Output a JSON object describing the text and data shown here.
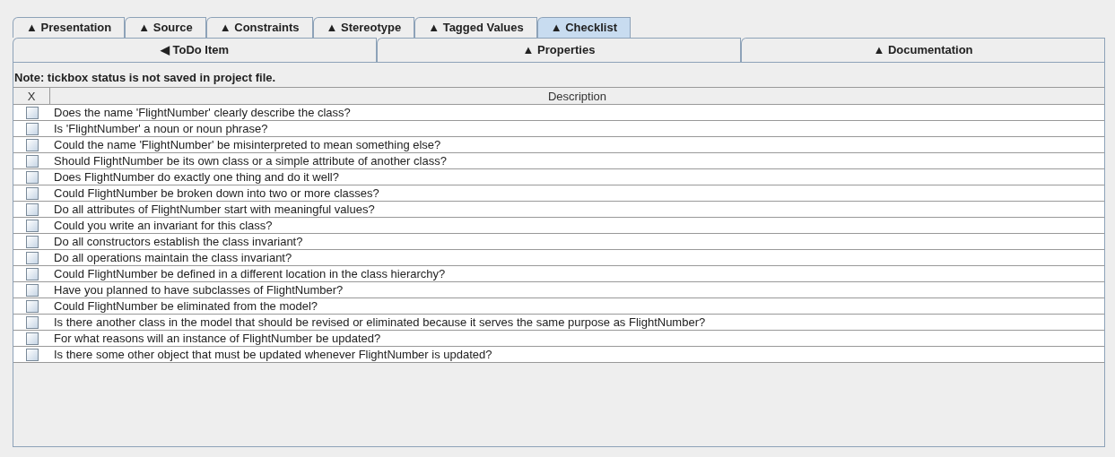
{
  "tabs_row_1": [
    {
      "label": "▲ Presentation",
      "selected": false
    },
    {
      "label": "▲ Source",
      "selected": false
    },
    {
      "label": "▲ Constraints",
      "selected": false
    },
    {
      "label": "▲ Stereotype",
      "selected": false
    },
    {
      "label": "▲ Tagged Values",
      "selected": false
    },
    {
      "label": "▲ Checklist",
      "selected": true
    }
  ],
  "tabs_row_2": [
    {
      "label": "◀ ToDo Item",
      "selected": false
    },
    {
      "label": "▲ Properties",
      "selected": false
    },
    {
      "label": "▲ Documentation",
      "selected": false
    }
  ],
  "note": "Note: tickbox status is not saved in project file.",
  "table": {
    "columns": [
      "X",
      "Description"
    ],
    "rows": [
      {
        "checked": false,
        "description": "Does the name 'FlightNumber' clearly describe the class?"
      },
      {
        "checked": false,
        "description": "Is 'FlightNumber' a noun or noun phrase?"
      },
      {
        "checked": false,
        "description": "Could the name 'FlightNumber' be misinterpreted to mean something else?"
      },
      {
        "checked": false,
        "description": "Should FlightNumber be its own class or a simple attribute of another class?"
      },
      {
        "checked": false,
        "description": "Does FlightNumber do exactly one thing and do it well?"
      },
      {
        "checked": false,
        "description": "Could FlightNumber be broken down into two or more classes?"
      },
      {
        "checked": false,
        "description": "Do all attributes of FlightNumber start with meaningful values?"
      },
      {
        "checked": false,
        "description": "Could you write an invariant for this class?"
      },
      {
        "checked": false,
        "description": "Do all constructors establish the class invariant?"
      },
      {
        "checked": false,
        "description": "Do all operations maintain the class invariant?"
      },
      {
        "checked": false,
        "description": "Could FlightNumber be defined in a different location in the class hierarchy?"
      },
      {
        "checked": false,
        "description": "Have you planned to have subclasses of FlightNumber?"
      },
      {
        "checked": false,
        "description": "Could FlightNumber be eliminated from the model?"
      },
      {
        "checked": false,
        "description": "Is there another class in the model that should be revised or eliminated because it serves the same purpose as FlightNumber?"
      },
      {
        "checked": false,
        "description": "For what reasons will an instance of FlightNumber be updated?"
      },
      {
        "checked": false,
        "description": "Is there some other object that must be updated whenever FlightNumber is updated?"
      }
    ]
  }
}
